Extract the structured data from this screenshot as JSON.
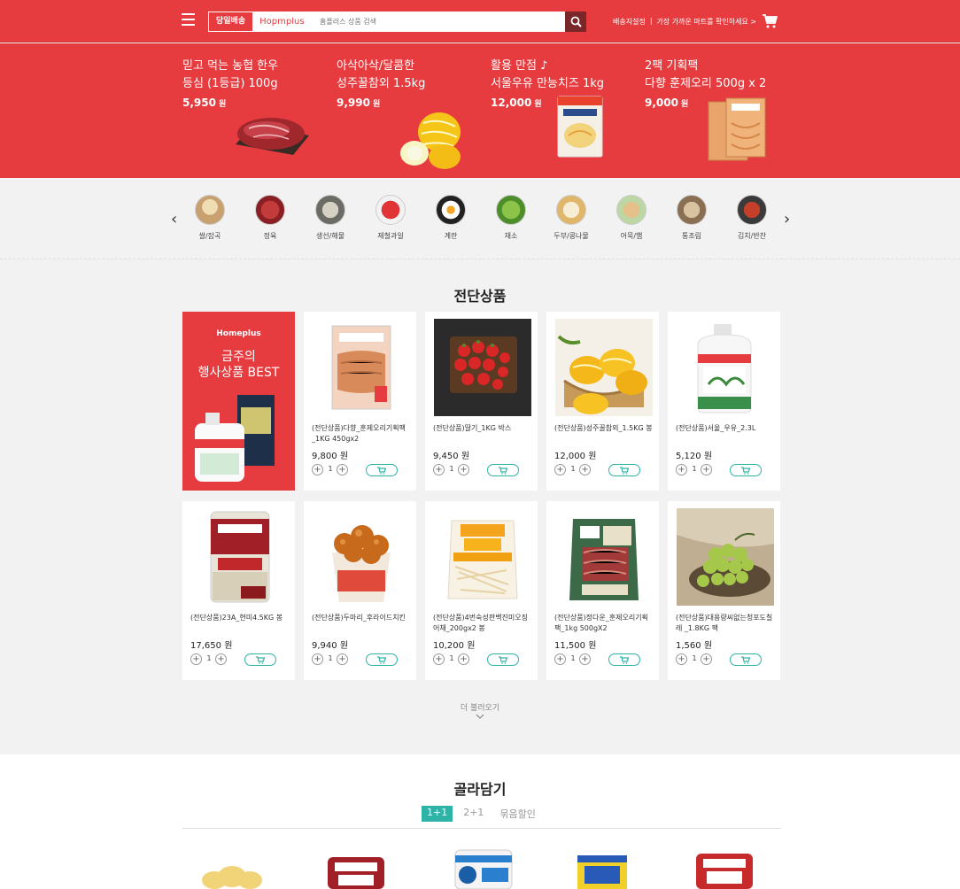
{
  "header": {
    "delivery_tab_same_day": "당일배송",
    "delivery_tab_brand": "Hopmplus",
    "search_placeholder": "홈플러스 상품 검색",
    "link_address": "배송지설정",
    "link_separator": "|",
    "link_store": "가장 가까운 마트를 확인하세요 >",
    "brand_color": "#e63c40"
  },
  "banner": [
    {
      "title": "믿고 먹는 농협 한우\n등심 (1등급) 100g",
      "price": "5,950",
      "unit": "원"
    },
    {
      "title": "아삭아삭/달콤한\n성주꿀참외 1.5kg",
      "price": "9,990",
      "unit": "원"
    },
    {
      "title": "활용 만점 ♪\n서울우유 만능치즈 1kg",
      "price": "12,000",
      "unit": "원"
    },
    {
      "title": "2팩 기획팩\n다향 훈제오리 500g x 2",
      "price": "9,000",
      "unit": "원"
    }
  ],
  "categories": [
    {
      "label": "쌀/잡곡",
      "icon": "rice-icon"
    },
    {
      "label": "정육",
      "icon": "meat-icon"
    },
    {
      "label": "생선/해물",
      "icon": "seafood-icon"
    },
    {
      "label": "제철과일",
      "icon": "fruit-icon"
    },
    {
      "label": "계란",
      "icon": "egg-icon"
    },
    {
      "label": "채소",
      "icon": "vegetable-icon"
    },
    {
      "label": "두부/콩나물",
      "icon": "tofu-icon"
    },
    {
      "label": "어묵/햄",
      "icon": "fishcake-icon"
    },
    {
      "label": "통조림",
      "icon": "canned-icon"
    },
    {
      "label": "김치/반찬",
      "icon": "kimchi-icon"
    }
  ],
  "flyer": {
    "title": "전단상품",
    "promo_brand": "Homeplus",
    "promo_title": "금주의\n행사상품 BEST",
    "currency": "원",
    "qty": "1",
    "products": [
      {
        "name": "(전단상품)다향_훈제오리기획팩_1KG 450gx2",
        "price": "9,800"
      },
      {
        "name": "(전단상품)딸기_1KG 박스",
        "price": "9,450"
      },
      {
        "name": "(전단상품)성주꿀참외_1.5KG 봉",
        "price": "12,000"
      },
      {
        "name": "(전단상품)서울_우유_2.3L",
        "price": "5,120"
      },
      {
        "name": "(전단상품)23A_현미4.5KG 봉",
        "price": "17,650"
      },
      {
        "name": "(전단상품)두마리_후라이드치킨",
        "price": "9,940"
      },
      {
        "name": "(전단상품)4번숙성판백진미오징어채_200gx2 봉",
        "price": "10,200"
      },
      {
        "name": "(전단상품)정다운_훈제오리기획팩_1kg 500gX2",
        "price": "11,500"
      },
      {
        "name": "(전단상품)대용량씨없는청포도칠레 _1.8KG 팩",
        "price": "1,560"
      }
    ],
    "load_more": "더 불러오기"
  },
  "pick": {
    "title": "골라담기",
    "tabs": [
      "1+1",
      "2+1",
      "묶음할인"
    ]
  },
  "accent_color": "#2eb3a6"
}
